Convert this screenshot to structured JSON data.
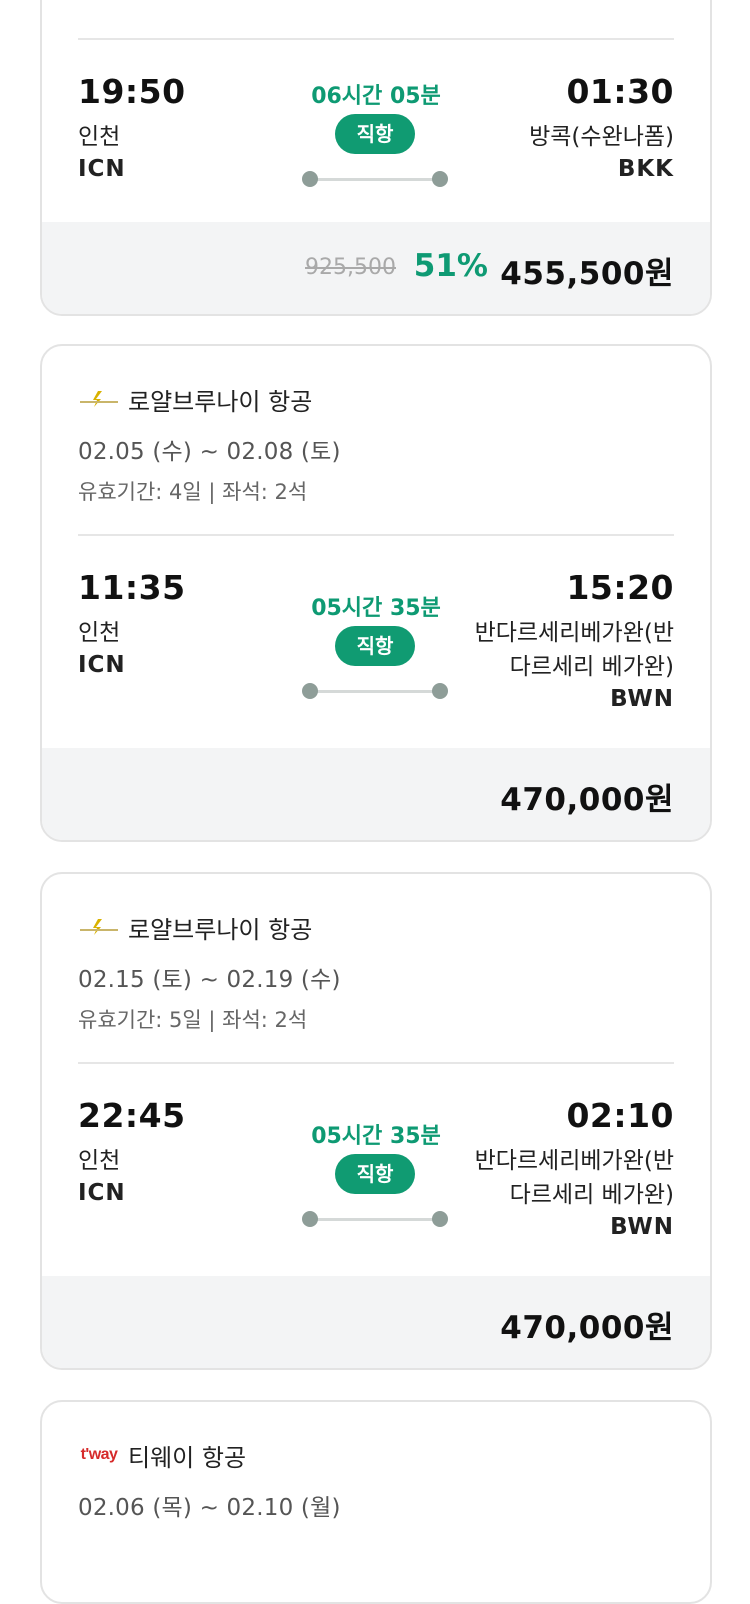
{
  "cards": [
    {
      "flight": {
        "dep_time": "19:50",
        "dep_city": "인천",
        "dep_code": "ICN",
        "arr_time": "01:30",
        "arr_city": "방콕(수완나폼)",
        "arr_code": "BKK",
        "duration": "06시간 05분",
        "type": "직항"
      },
      "price": {
        "original": "925,500",
        "discount": "51%",
        "final": "455,500원"
      }
    },
    {
      "airline": "로얄브루나이 항공",
      "logo_icon": "royal-brunei-logo-icon",
      "dates": "02.05 (수) ~ 02.08 (토)",
      "meta": "유효기간: 4일 | 좌석: 2석",
      "flight": {
        "dep_time": "11:35",
        "dep_city": "인천",
        "dep_code": "ICN",
        "arr_time": "15:20",
        "arr_city_1": "반다르세리베가완(반",
        "arr_city_2": "다르세리 베가완)",
        "arr_code": "BWN",
        "duration": "05시간 35분",
        "type": "직항"
      },
      "price": {
        "final": "470,000원"
      }
    },
    {
      "airline": "로얄브루나이 항공",
      "logo_icon": "royal-brunei-logo-icon",
      "dates": "02.15 (토) ~ 02.19 (수)",
      "meta": "유효기간: 5일 | 좌석: 2석",
      "flight": {
        "dep_time": "22:45",
        "dep_city": "인천",
        "dep_code": "ICN",
        "arr_time": "02:10",
        "arr_city_1": "반다르세리베가완(반",
        "arr_city_2": "다르세리 베가완)",
        "arr_code": "BWN",
        "duration": "05시간 35분",
        "type": "직항"
      },
      "price": {
        "final": "470,000원"
      }
    },
    {
      "airline": "티웨이 항공",
      "logo_text": "t'way",
      "dates": "02.06 (목) ~ 02.10 (월)"
    }
  ],
  "colors": {
    "accent": "#109b72",
    "price_bar": "#f3f4f5",
    "border": "#e3e3e3"
  }
}
